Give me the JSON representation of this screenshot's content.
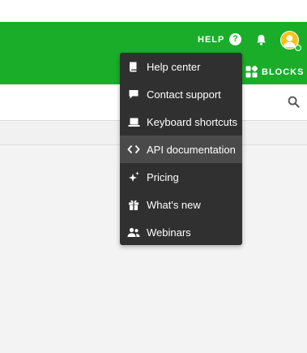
{
  "header": {
    "help_label": "HELP",
    "help_icon_glyph": "?",
    "blocks_label": "BLOCKS",
    "brand_color": "#1aad2a"
  },
  "help_menu": {
    "items": [
      {
        "label": "Help center",
        "icon": "book-icon"
      },
      {
        "label": "Contact support",
        "icon": "chat-bubble-icon"
      },
      {
        "label": "Keyboard shortcuts",
        "icon": "laptop-icon"
      },
      {
        "label": "API documentation",
        "icon": "code-icon",
        "active": true
      },
      {
        "label": "Pricing",
        "icon": "sparkles-icon"
      },
      {
        "label": "What's new",
        "icon": "gift-icon"
      },
      {
        "label": "Webinars",
        "icon": "people-icon"
      }
    ]
  }
}
